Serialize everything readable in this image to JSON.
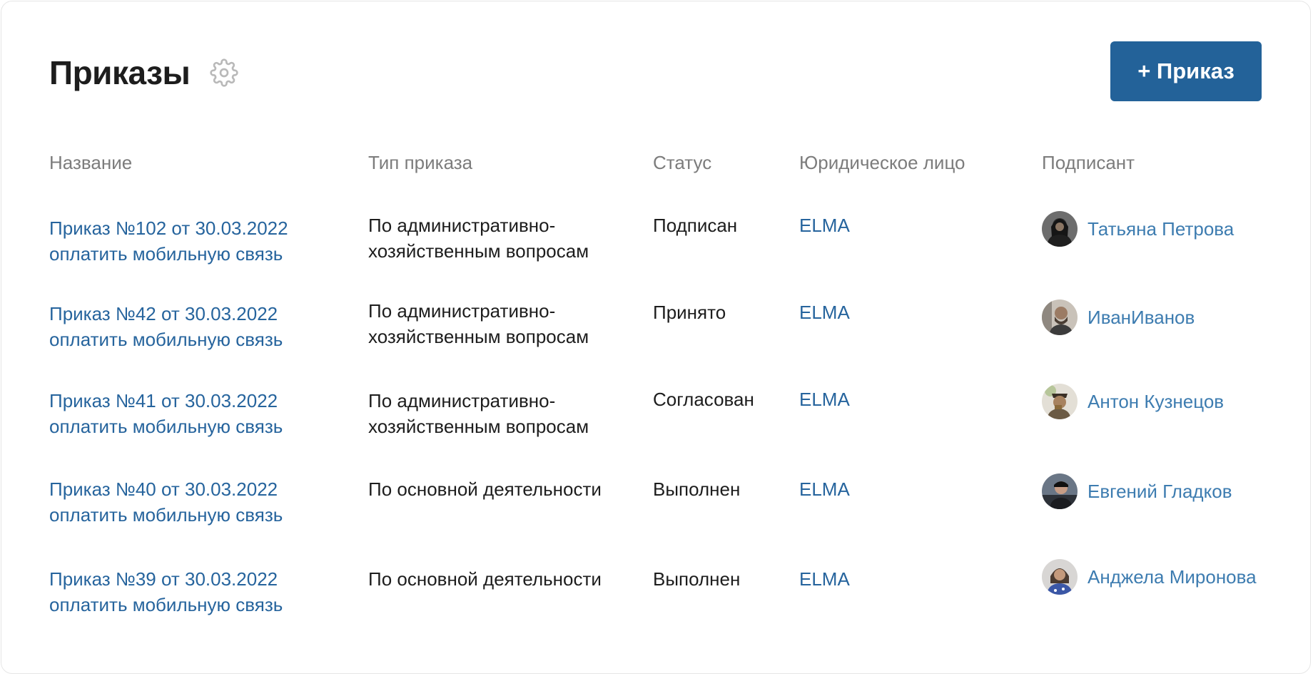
{
  "header": {
    "title": "Приказы",
    "settings_icon": "gear-icon",
    "add_button_label": "+ Приказ"
  },
  "colors": {
    "accent": "#236299",
    "link": "#26649d",
    "header_text": "#7c7c7c"
  },
  "table": {
    "columns": [
      "Название",
      "Тип приказа",
      "Статус",
      "Юридическое лицо",
      "Подписант"
    ],
    "rows": [
      {
        "name_line1": "Приказ №102 от 30.03.2022",
        "name_line2": "оплатить мобильную связь",
        "type": "По административно-хозяйственным вопросам",
        "status": "Подписан",
        "entity": "ELMA",
        "signer": "Татьяна Петрова"
      },
      {
        "name_line1": "Приказ №42 от 30.03.2022",
        "name_line2": "оплатить мобильную связь",
        "type": "По административно-хозяйственным вопросам",
        "status": "Принято",
        "entity": "ELMA",
        "signer": "ИванИванов"
      },
      {
        "name_line1": "Приказ №41 от 30.03.2022",
        "name_line2": "оплатить мобильную связь",
        "type": "По административно-хозяйственным вопросам",
        "status": "Согласован",
        "entity": "ELMA",
        "signer": "Антон Кузнецов"
      },
      {
        "name_line1": "Приказ №40 от 30.03.2022",
        "name_line2": "оплатить мобильную связь",
        "type": "По основной деятельности",
        "status": "Выполнен",
        "entity": "ELMA",
        "signer": "Евгений Гладков"
      },
      {
        "name_line1": "Приказ №39 от 30.03.2022",
        "name_line2": "оплатить мобильную связь",
        "type": "По основной деятельности",
        "status": "Выполнен",
        "entity": "ELMA",
        "signer": "Анджела Миронова"
      }
    ]
  }
}
